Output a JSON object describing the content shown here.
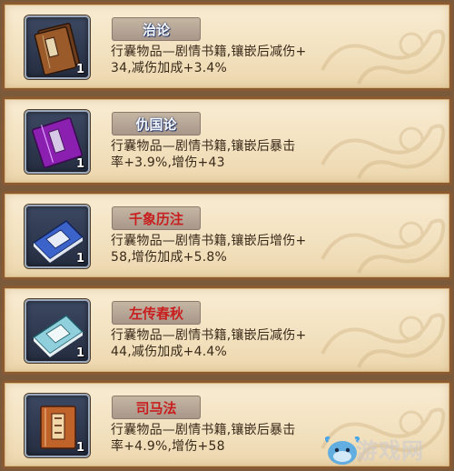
{
  "items": [
    {
      "name": "治论",
      "name_color": "#f4f8ff",
      "count": "1",
      "description_line1": "行囊物品—剧情书籍,镶嵌后减伤+",
      "description_line2": "34,减伤加成+3.4%",
      "icon": "brown-book-icon"
    },
    {
      "name": "仇国论",
      "name_color": "#f4f8ff",
      "count": "1",
      "description_line1": "行囊物品—剧情书籍,镶嵌后暴击",
      "description_line2": "率+3.9%,增伤+43",
      "icon": "purple-book-icon"
    },
    {
      "name": "千象历注",
      "name_color": "#c81e1e",
      "count": "1",
      "description_line1": "行囊物品—剧情书籍,镶嵌后增伤+",
      "description_line2": "58,增伤加成+5.8%",
      "icon": "blue-book-icon"
    },
    {
      "name": "左传春秋",
      "name_color": "#c81e1e",
      "count": "1",
      "description_line1": "行囊物品—剧情书籍,镶嵌后减伤+",
      "description_line2": "44,减伤加成+4.4%",
      "icon": "teal-book-icon"
    },
    {
      "name": "司马法",
      "name_color": "#c81e1e",
      "count": "1",
      "description_line1": "行囊物品—剧情书籍,镶嵌后暴击",
      "description_line2": "率+4.9%,增伤+58",
      "icon": "orange-book-icon"
    }
  ],
  "watermark": {
    "text": "游戏网",
    "icon": "cow-mascot-icon"
  }
}
